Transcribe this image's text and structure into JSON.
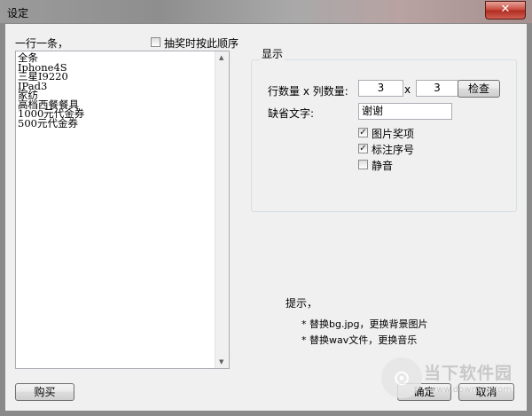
{
  "window": {
    "title": "设定",
    "close_label": "✕"
  },
  "left": {
    "list_header": "一行一条，",
    "order_checkbox": {
      "label": "抽奖时按此顺序",
      "checked": false
    },
    "items": [
      "全条",
      "Iphone4S",
      "三星I9220",
      "IPad3",
      "家纺",
      "高档西餐餐具",
      "1000元代金券",
      "500元代金券"
    ],
    "buy_button": "购买"
  },
  "display": {
    "group_label": "显示",
    "rows_cols_label": "行数量 x 列数量:",
    "rows_value": "3",
    "x_label": "x",
    "cols_value": "3",
    "check_button": "检查",
    "default_text_label": "缺省文字:",
    "default_text_value": "谢谢",
    "options": [
      {
        "label": "图片奖项",
        "checked": true
      },
      {
        "label": "标注序号",
        "checked": true
      },
      {
        "label": "静音",
        "checked": false
      }
    ]
  },
  "hints": {
    "title": "提示，",
    "lines": [
      "* 替换bg.jpg，更换背景图片",
      "* 替换wav文件，更换音乐"
    ]
  },
  "buttons": {
    "ok": "确定",
    "cancel": "取消"
  },
  "watermark": {
    "text": "当下软件园",
    "url": "www.downxia.com"
  }
}
